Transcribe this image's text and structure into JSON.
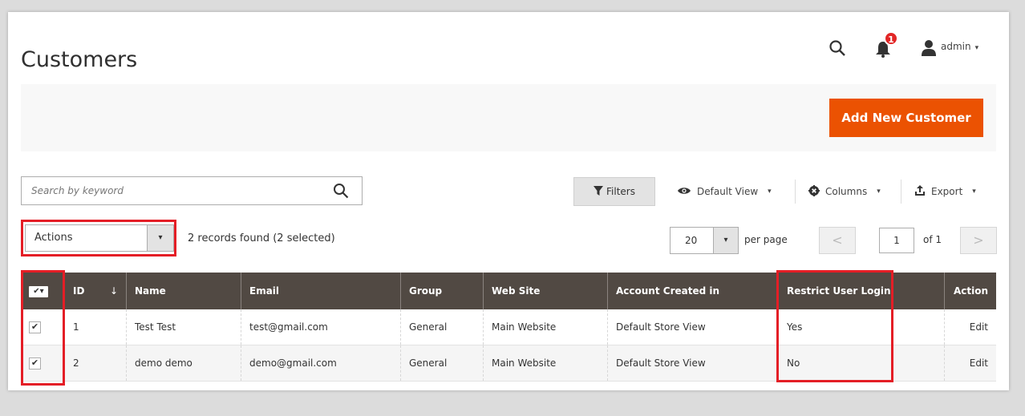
{
  "header": {
    "title": "Customers",
    "notification_count": "1",
    "user_name": "admin",
    "caret": "▾"
  },
  "action_bar": {
    "add_button": "Add New Customer"
  },
  "toolbar": {
    "search_placeholder": "Search by keyword",
    "filters_label": "Filters",
    "view_label": "Default View",
    "columns_label": "Columns",
    "export_label": "Export"
  },
  "mass_actions": {
    "select_label": "Actions",
    "records_text": "2 records found (2 selected)"
  },
  "pager": {
    "per_page_value": "20",
    "per_page_label": "per page",
    "prev": "<",
    "next": ">",
    "current_page": "1",
    "of_text": "of 1"
  },
  "table": {
    "columns": [
      "ID",
      "Name",
      "Email",
      "Group",
      "Web Site",
      "Account Created in",
      "Restrict User Login",
      "Action"
    ],
    "sort_indicator": "↓",
    "rows": [
      {
        "id": "1",
        "name": "Test Test",
        "email": "test@gmail.com",
        "group": "General",
        "website": "Main Website",
        "created_in": "Default Store View",
        "restrict": "Yes",
        "action": "Edit"
      },
      {
        "id": "2",
        "name": "demo demo",
        "email": "demo@gmail.com",
        "group": "General",
        "website": "Main Website",
        "created_in": "Default Store View",
        "restrict": "No",
        "action": "Edit"
      }
    ]
  },
  "colors": {
    "accent": "#eb5202",
    "header_bg": "#514943",
    "highlight": "#e41e26",
    "link": "#007bdb"
  }
}
